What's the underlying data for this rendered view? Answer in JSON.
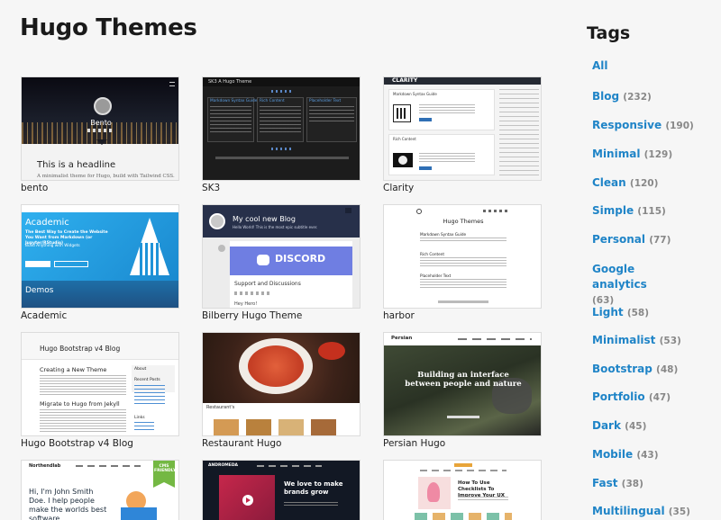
{
  "header": {
    "title": "Hugo Themes"
  },
  "sidebar": {
    "title": "Tags",
    "tags": [
      {
        "label": "All",
        "count": ""
      },
      {
        "label": "Blog",
        "count": "(232)"
      },
      {
        "label": "Responsive",
        "count": "(190)"
      },
      {
        "label": "Minimal",
        "count": "(129)"
      },
      {
        "label": "Clean",
        "count": "(120)"
      },
      {
        "label": "Simple",
        "count": "(115)"
      },
      {
        "label": "Personal",
        "count": "(77)"
      },
      {
        "label": "Google analytics",
        "count": "(63)"
      },
      {
        "label": "Light",
        "count": "(58)"
      },
      {
        "label": "Minimalist",
        "count": "(53)"
      },
      {
        "label": "Bootstrap",
        "count": "(48)"
      },
      {
        "label": "Portfolio",
        "count": "(47)"
      },
      {
        "label": "Dark",
        "count": "(45)"
      },
      {
        "label": "Mobile",
        "count": "(43)"
      },
      {
        "label": "Fast",
        "count": "(38)"
      },
      {
        "label": "Multilingual",
        "count": "(35)"
      }
    ]
  },
  "themes": [
    {
      "name": "bento",
      "thumb": {
        "headline": "This is a headline",
        "sub": "A minimalist theme for Hugo, build with Tailwind CSS.",
        "brand": "Bento"
      }
    },
    {
      "name": "SK3",
      "thumb": {
        "brand": "SK3 A Hugo Theme",
        "post1": "Markdown Syntax Guide",
        "post2": "Rich Content",
        "post3": "Placeholder Text"
      }
    },
    {
      "name": "Clarity",
      "thumb": {
        "brand": "CLARITY",
        "post1": "Markdown Syntax Guide",
        "post2": "Rich Content"
      }
    },
    {
      "name": "Academic",
      "thumb": {
        "brand": "Academic",
        "line1": "The Best Way to Create the Website You Want from Markdown (or Jupyter/RStudio)",
        "line2": "Build Anything with Widgets",
        "demos": "Demos"
      }
    },
    {
      "name": "Bilberry Hugo Theme",
      "thumb": {
        "title": "My cool new Blog",
        "sub": "Hello World! This is the most epic subtitle ever.",
        "discord": "DISCORD",
        "support": "Support and Discussions",
        "hey": "Hey Hero!"
      }
    },
    {
      "name": "harbor",
      "thumb": {
        "title": "Hugo Themes",
        "post1": "Markdown Syntax Guide",
        "post2": "Rich Content",
        "post3": "Placeholder Text"
      }
    },
    {
      "name": "Hugo Bootstrap v4 Blog",
      "thumb": {
        "title": "Hugo Bootstrap v4 Blog",
        "h1": "Creating a New Theme",
        "h2": "Migrate to Hugo from Jekyll",
        "about": "About",
        "recent": "Recent Posts",
        "links": "Links"
      }
    },
    {
      "name": "Restaurant Hugo",
      "thumb": {
        "brand": "Restaurant's"
      }
    },
    {
      "name": "Persian Hugo",
      "thumb": {
        "brand": "Persian",
        "hero": "Building an interface between people and nature"
      }
    },
    {
      "name": "",
      "thumb": {
        "brand": "Northendlab",
        "hero": "Hi, I'm John Smith Doe. I help people make the worlds best software",
        "cms": "CMS FRIENDLY"
      }
    },
    {
      "name": "",
      "thumb": {
        "brand": "ANDROMEDA",
        "hero": "We love to make brands grow"
      }
    },
    {
      "name": "",
      "thumb": {
        "hero": "How To Use Checklists To Improve Your UX"
      }
    }
  ],
  "colors": {
    "accent": "#1f84c7",
    "count": "#888888",
    "background": "#f6f6f6"
  }
}
